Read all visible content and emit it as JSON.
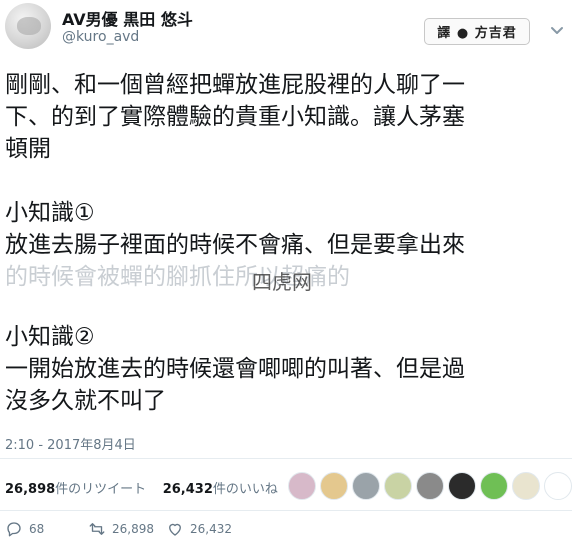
{
  "author": {
    "name": "AV男優 黒田 悠斗",
    "handle": "@kuro_avd"
  },
  "translate_badge": "譯 ● 方吉君",
  "tweet": {
    "lines": [
      "剛剛、和一個曾經把蟬放進屁股裡的人聊了一",
      "下、的到了實際體驗的貴重小知識。讓人茅塞",
      "頓開",
      "小知識①",
      "放進去腸子裡面的時候不會痛、但是要拿出來",
      "的時候會被蟬的腳抓住所以超痛的",
      "小知識②",
      "一開始放進去的時候還會唧唧的叫著、但是過",
      "沒多久就不叫了"
    ],
    "watermark": "四虎网"
  },
  "timestamp": "2:10 - 2017年8月4日",
  "stats": {
    "retweets_count": "26,898",
    "retweets_label": "件のリツイート",
    "likes_count": "26,432",
    "likes_label": "件のいいね"
  },
  "actions": {
    "reply_count": "68",
    "retweet_count": "26,898",
    "like_count": "26,432"
  },
  "colors": {
    "text": "#14171a",
    "muted": "#657786",
    "divider": "#e6ecf0"
  },
  "icons": [
    "chevron-down-icon",
    "reply-icon",
    "retweet-icon",
    "like-icon"
  ]
}
